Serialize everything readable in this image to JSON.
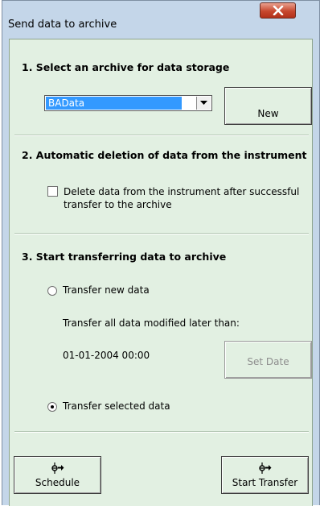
{
  "window": {
    "title": "Send data to archive",
    "close_icon": "close-icon"
  },
  "section1": {
    "heading": "1.  Select an archive for data storage",
    "archive_select": {
      "selected": "BAData"
    },
    "new_button": "New"
  },
  "section2": {
    "heading": "2.  Automatic deletion of data from the instrument",
    "delete_checkbox": {
      "checked": false,
      "label_line1": "Delete data from the instrument after successful",
      "label_line2": "transfer to the archive"
    }
  },
  "section3": {
    "heading": "3.  Start transferring data to archive",
    "transfer_new": {
      "label": "Transfer new data",
      "checked": false
    },
    "modified_label": "Transfer all data modified later than:",
    "date_value": "01-01-2004 00:00",
    "set_date_button": "Set Date",
    "transfer_selected": {
      "label": "Transfer selected data",
      "checked": true
    }
  },
  "footer": {
    "schedule_button": "Schedule",
    "start_transfer_button": "Start Transfer",
    "button_icon": "instrument-transfer-icon"
  },
  "colors": {
    "panel_background": "#e2f0e2",
    "window_frame": "#c4d6e9",
    "selection": "#3399ff",
    "close_button": "#c7482e"
  }
}
